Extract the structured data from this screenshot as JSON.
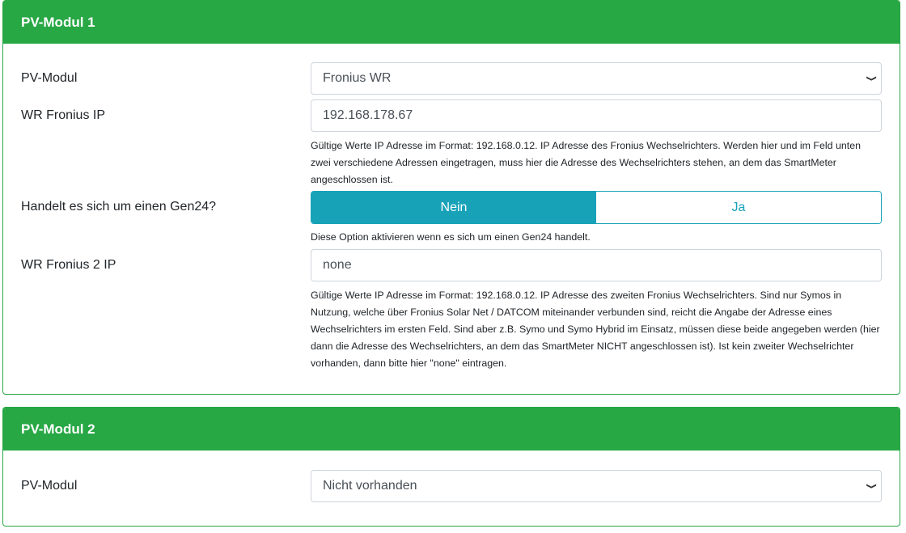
{
  "module1": {
    "title": "PV-Modul 1",
    "pv_label": "PV-Modul",
    "pv_value": "Fronius WR",
    "ip_label": "WR Fronius IP",
    "ip_value": "192.168.178.67",
    "ip_help": "Gültige Werte IP Adresse im Format: 192.168.0.12. IP Adresse des Fronius Wechselrichters. Werden hier und im Feld unten zwei verschiedene Adressen eingetragen, muss hier die Adresse des Wechselrichters stehen, an dem das SmartMeter angeschlossen ist.",
    "gen24_label": "Handelt es sich um einen Gen24?",
    "gen24_no": "Nein",
    "gen24_yes": "Ja",
    "gen24_help": "Diese Option aktivieren wenn es sich um einen Gen24 handelt.",
    "ip2_label": "WR Fronius 2 IP",
    "ip2_value": "none",
    "ip2_help": "Gültige Werte IP Adresse im Format: 192.168.0.12. IP Adresse des zweiten Fronius Wechselrichters. Sind nur Symos in Nutzung, welche über Fronius Solar Net / DATCOM miteinander verbunden sind, reicht die Angabe der Adresse eines Wechselrichters im ersten Feld. Sind aber z.B. Symo und Symo Hybrid im Einsatz, müssen diese beide angegeben werden (hier dann die Adresse des Wechselrichters, an dem das SmartMeter NICHT angeschlossen ist). Ist kein zweiter Wechselrichter vorhanden, dann bitte hier \"none\" eintragen."
  },
  "module2": {
    "title": "PV-Modul 2",
    "pv_label": "PV-Modul",
    "pv_value": "Nicht vorhanden"
  },
  "colors": {
    "header": "#28a745",
    "toggle": "#17a2b8"
  }
}
